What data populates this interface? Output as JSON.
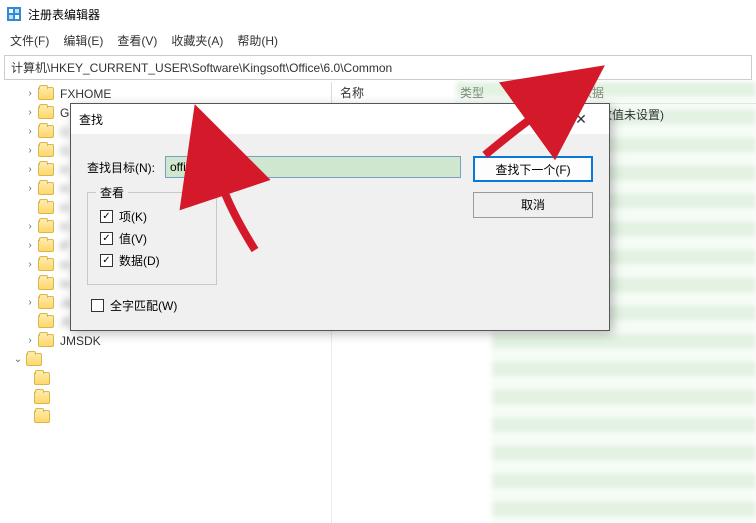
{
  "window": {
    "title": "注册表编辑器"
  },
  "menu": {
    "file": "文件(F)",
    "edit": "编辑(E)",
    "view": "查看(V)",
    "favorites": "收藏夹(A)",
    "help": "帮助(H)"
  },
  "path": "计算机\\HKEY_CURRENT_USER\\Software\\Kingsoft\\Office\\6.0\\Common",
  "tree": {
    "items": [
      "FXHOME",
      "Gabest",
      "G",
      "G",
      "H",
      "H",
      "H",
      "H",
      "iF",
      "In",
      "In",
      "Ja",
      "JC",
      "JMSDK"
    ]
  },
  "list": {
    "headers": {
      "name": "名称",
      "type": "类型",
      "data": "数据"
    },
    "default_row": {
      "data": "(数值未设置)"
    }
  },
  "dialog": {
    "title": "查找",
    "find_label": "查找目标(N):",
    "find_value": "office",
    "look_at_legend": "查看",
    "keys": "项(K)",
    "values": "值(V)",
    "data": "数据(D)",
    "whole": "全字匹配(W)",
    "find_next": "查找下一个(F)",
    "cancel": "取消"
  }
}
